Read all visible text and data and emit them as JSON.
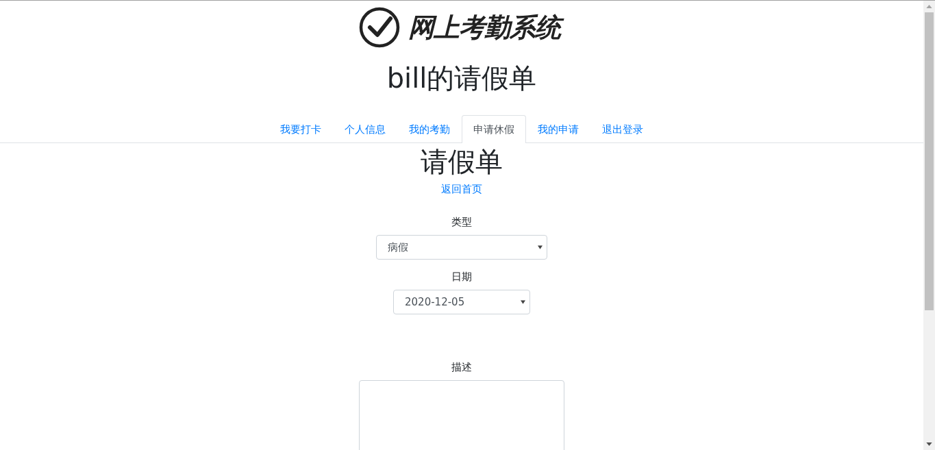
{
  "header": {
    "logo_text": "网上考勤系统",
    "title": "bill的请假单"
  },
  "tabs": [
    {
      "label": "我要打卡",
      "selected": false
    },
    {
      "label": "个人信息",
      "selected": false
    },
    {
      "label": "我的考勤",
      "selected": false
    },
    {
      "label": "申请休假",
      "selected": true
    },
    {
      "label": "我的申请",
      "selected": false
    },
    {
      "label": "退出登录",
      "selected": false
    }
  ],
  "form": {
    "heading": "请假单",
    "back_link": "返回首页",
    "fields": [
      {
        "kind": "select",
        "label": "类型",
        "value": "病假"
      },
      {
        "kind": "select",
        "label": "日期",
        "value": "2020-12-05"
      },
      {
        "kind": "textarea",
        "label": "描述"
      }
    ]
  }
}
